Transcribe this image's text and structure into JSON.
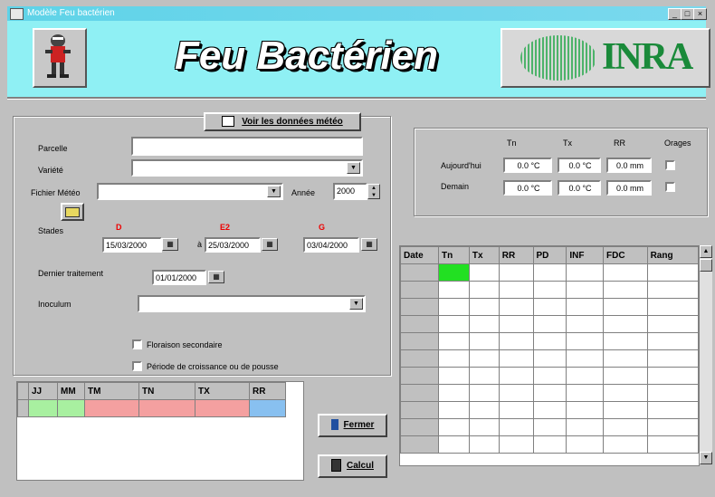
{
  "window": {
    "title": "Modèle Feu bactérien",
    "min_label": "_",
    "max_label": "□",
    "close_label": "×"
  },
  "header": {
    "app_title": "Feu Bactérien",
    "brand": "INRA"
  },
  "meteo_button": {
    "label": "Voir les données météo"
  },
  "form": {
    "parcelle_label": "Parcelle",
    "parcelle_value": "",
    "variete_label": "Variété",
    "variete_value": "",
    "fichier_label": "Fichier Météo",
    "fichier_value": "",
    "annee_label": "Année",
    "annee_value": "2000",
    "stades_label": "Stades",
    "stage_codes": [
      "D",
      "E2",
      "G"
    ],
    "stage_dates": [
      "15/03/2000",
      "25/03/2000",
      "03/04/2000"
    ],
    "stage_prefix": "à",
    "dernier_label": "Dernier traitement",
    "dernier_value": "01/01/2000",
    "inoculum_label": "Inoculum",
    "inoculum_value": "",
    "floraison_label": "Floraison secondaire",
    "periode_label": "Période de croissance ou de pousse"
  },
  "forecast": {
    "col_tn": "Tn",
    "col_tx": "Tx",
    "col_rr": "RR",
    "col_orages": "Orages",
    "rows": [
      {
        "label": "Aujourd'hui",
        "tn": "0.0 °C",
        "tx": "0.0 °C",
        "rr": "0.0 mm"
      },
      {
        "label": "Demain",
        "tn": "0.0 °C",
        "tx": "0.0 °C",
        "rr": "0.0 mm"
      }
    ]
  },
  "small_table": {
    "headers": [
      "JJ",
      "MM",
      "TM",
      "TN",
      "TX",
      "RR"
    ],
    "colors": {
      "green": "#a8f0a0",
      "pink": "#f4a0a0",
      "blue": "#88c0f0"
    }
  },
  "big_table": {
    "headers": [
      "Date",
      "Tn",
      "Tx",
      "RR",
      "PD",
      "INF",
      "FDC",
      "Rang"
    ],
    "row_count": 11,
    "highlight_color": "#22e022"
  },
  "buttons": {
    "fermer": "Fermer",
    "calcul": "Calcul"
  }
}
